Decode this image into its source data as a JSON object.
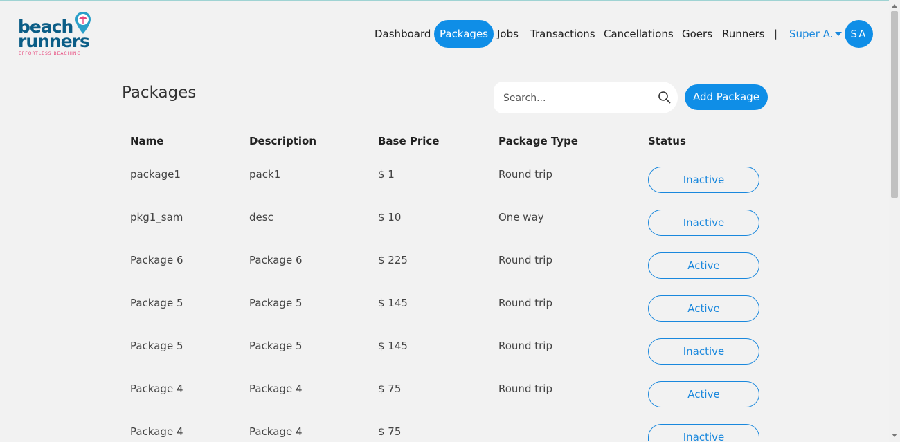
{
  "logo": {
    "line1": "beach",
    "line2": "runners",
    "tagline": "EFFORTLESS BEACHING"
  },
  "nav": {
    "items": [
      "Dashboard",
      "Packages",
      "Jobs",
      "Transactions",
      "Cancellations",
      "Goers",
      "Runners"
    ],
    "active": "Packages",
    "separator": "|",
    "user_name": "Super A.",
    "avatar_initials": "SA"
  },
  "page": {
    "title": "Packages"
  },
  "search": {
    "placeholder": "Search...",
    "value": ""
  },
  "add_button": "Add Package",
  "table": {
    "columns": [
      "Name",
      "Description",
      "Base Price",
      "Package Type",
      "Status"
    ],
    "rows": [
      {
        "name": "package1",
        "description": "pack1",
        "price": "$ 1",
        "type": "Round trip",
        "status": "Inactive"
      },
      {
        "name": "pkg1_sam",
        "description": "desc",
        "price": "$ 10",
        "type": "One way",
        "status": "Inactive"
      },
      {
        "name": "Package 6",
        "description": "Package 6",
        "price": "$ 225",
        "type": "Round trip",
        "status": "Active"
      },
      {
        "name": "Package 5",
        "description": "Package 5",
        "price": "$ 145",
        "type": "Round trip",
        "status": "Active"
      },
      {
        "name": "Package 5",
        "description": "Package 5",
        "price": "$ 145",
        "type": "Round trip",
        "status": "Inactive"
      },
      {
        "name": "Package 4",
        "description": "Package 4",
        "price": "$ 75",
        "type": "Round trip",
        "status": "Active"
      },
      {
        "name": "Package 4",
        "description": "Package 4",
        "price": "$ 75",
        "type": "",
        "status": "Inactive"
      }
    ]
  },
  "colors": {
    "accent": "#0f8ee7",
    "brand_dark": "#0b5d86",
    "brand_pink": "#e8487d",
    "background": "#f2f2f2"
  }
}
